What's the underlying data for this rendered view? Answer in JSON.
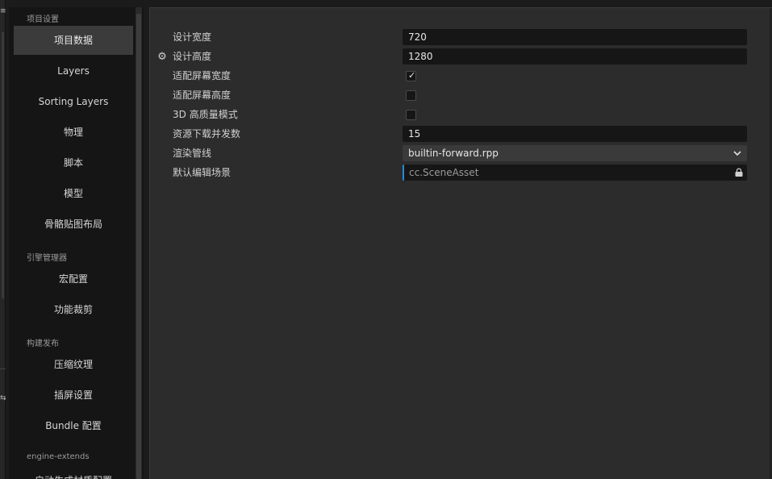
{
  "edge": {
    "top_glyph": "≡",
    "bottom_glyph": "⇆"
  },
  "sidebar": {
    "groups": [
      {
        "label": "项目设置",
        "items": [
          "项目数据",
          "Layers",
          "Sorting Layers",
          "物理",
          "脚本",
          "模型",
          "骨骼贴图布局"
        ]
      },
      {
        "label": "引擎管理器",
        "items": [
          "宏配置",
          "功能裁剪"
        ]
      },
      {
        "label": "构建发布",
        "items": [
          "压缩纹理",
          "插屏设置",
          "Bundle 配置"
        ]
      },
      {
        "label": "engine-extends",
        "items": [
          "启动生成材质配置"
        ]
      }
    ],
    "active_item": "项目数据"
  },
  "properties": {
    "design_width": {
      "label": "设计宽度",
      "value": "720"
    },
    "design_height": {
      "label": "设计高度",
      "value": "1280"
    },
    "fit_width": {
      "label": "适配屏幕宽度",
      "checked": true
    },
    "fit_height": {
      "label": "适配屏幕高度",
      "checked": false
    },
    "hq_3d": {
      "label": "3D 高质量模式",
      "checked": false
    },
    "download_concurrency": {
      "label": "资源下载并发数",
      "value": "15"
    },
    "render_pipeline": {
      "label": "渲染管线",
      "value": "builtin-forward.rpp"
    },
    "default_scene": {
      "label": "默认编辑场景",
      "placeholder": "cc.SceneAsset"
    }
  },
  "colors": {
    "accent": "#2a8bd0",
    "panel": "#2c2c2c",
    "sidebar": "#151515",
    "field": "#161616"
  },
  "icons": {
    "gear": "gear-icon",
    "check": "check-icon",
    "chevron": "chevron-down-icon",
    "lock": "lock-icon"
  }
}
